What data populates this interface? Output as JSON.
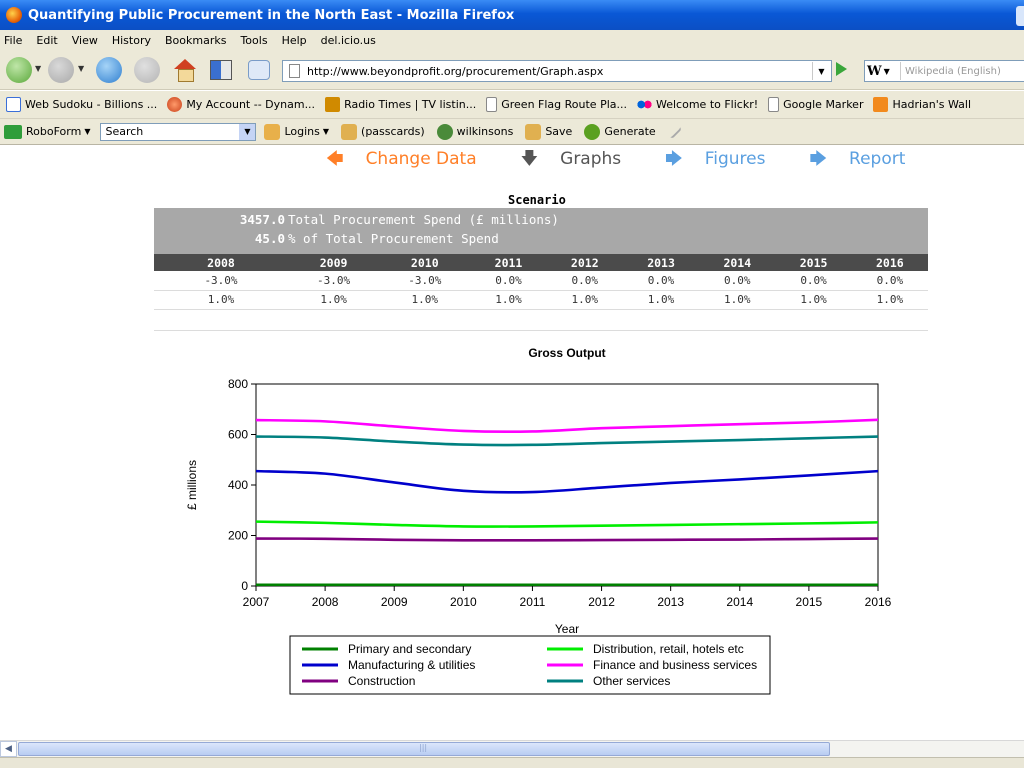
{
  "window": {
    "title": "Quantifying Public Procurement in the North East - Mozilla Firefox"
  },
  "menu": [
    "File",
    "Edit",
    "View",
    "History",
    "Bookmarks",
    "Tools",
    "Help",
    "del.icio.us"
  ],
  "address": {
    "url": "http://www.beyondprofit.org/procurement/Graph.aspx"
  },
  "search": {
    "engine_letter": "W",
    "placeholder": "Wikipedia (English)"
  },
  "bookmarks": [
    {
      "label": "Web Sudoku - Billions ...",
      "icon": "google-icon"
    },
    {
      "label": "My Account -- Dynam...",
      "icon": "globe-icon"
    },
    {
      "label": "Radio Times | TV listin...",
      "icon": "rt-icon"
    },
    {
      "label": "Green Flag Route Pla...",
      "icon": "page-icon"
    },
    {
      "label": "Welcome to Flickr!",
      "icon": "flickr-icon"
    },
    {
      "label": "Google Marker",
      "icon": "page-icon"
    },
    {
      "label": "Hadrian's Wall",
      "icon": "rss-icon"
    }
  ],
  "roboform": {
    "label": "RoboForm",
    "search_value": "Search",
    "items": [
      "Logins",
      "(passcards)",
      "wilkinsons",
      "Save",
      "Generate"
    ]
  },
  "page": {
    "links": {
      "change": "Change Data",
      "graphs": "Graphs",
      "figures": "Figures",
      "report": "Report"
    },
    "scenario": {
      "title": "Scenario",
      "spend_value": "3457.0",
      "spend_label": "Total Procurement Spend (£ millions)",
      "pct_value": "45.0",
      "pct_label": "% of Total Procurement Spend",
      "years": [
        "2008",
        "2009",
        "2010",
        "2011",
        "2012",
        "2013",
        "2014",
        "2015",
        "2016"
      ],
      "rows": [
        [
          "-3.0%",
          "-3.0%",
          "-3.0%",
          "0.0%",
          "0.0%",
          "0.0%",
          "0.0%",
          "0.0%",
          "0.0%"
        ],
        [
          "1.0%",
          "1.0%",
          "1.0%",
          "1.0%",
          "1.0%",
          "1.0%",
          "1.0%",
          "1.0%",
          "1.0%"
        ]
      ]
    }
  },
  "chart_data": {
    "type": "line",
    "title": "Gross Output",
    "xlabel": "Year",
    "ylabel": "£ millions",
    "xlim": [
      2007,
      2016
    ],
    "ylim": [
      0,
      800
    ],
    "yticks": [
      0,
      200,
      400,
      600,
      800
    ],
    "xticks": [
      2007,
      2008,
      2009,
      2010,
      2011,
      2012,
      2013,
      2014,
      2015,
      2016
    ],
    "grid": false,
    "legend_position": "bottom",
    "x": [
      2007,
      2008,
      2009,
      2010,
      2011,
      2012,
      2013,
      2014,
      2015,
      2016
    ],
    "series": [
      {
        "name": "Primary and secondary",
        "color": "#008000",
        "values": [
          5,
          5,
          5,
          5,
          5,
          5,
          5,
          5,
          5,
          5
        ]
      },
      {
        "name": "Distribution, retail, hotels etc",
        "color": "#00ee00",
        "values": [
          255,
          250,
          242,
          236,
          236,
          239,
          242,
          245,
          248,
          252
        ]
      },
      {
        "name": "Manufacturing & utilities",
        "color": "#0000cc",
        "values": [
          455,
          445,
          410,
          377,
          372,
          390,
          408,
          422,
          438,
          455
        ]
      },
      {
        "name": "Finance and business services",
        "color": "#ff00ff",
        "values": [
          657,
          652,
          632,
          614,
          612,
          625,
          633,
          641,
          648,
          658
        ]
      },
      {
        "name": "Construction",
        "color": "#800080",
        "values": [
          188,
          187,
          183,
          181,
          181,
          182,
          183,
          184,
          186,
          188
        ]
      },
      {
        "name": "Other services",
        "color": "#008080",
        "values": [
          592,
          588,
          572,
          560,
          559,
          566,
          572,
          578,
          585,
          592
        ]
      }
    ]
  }
}
